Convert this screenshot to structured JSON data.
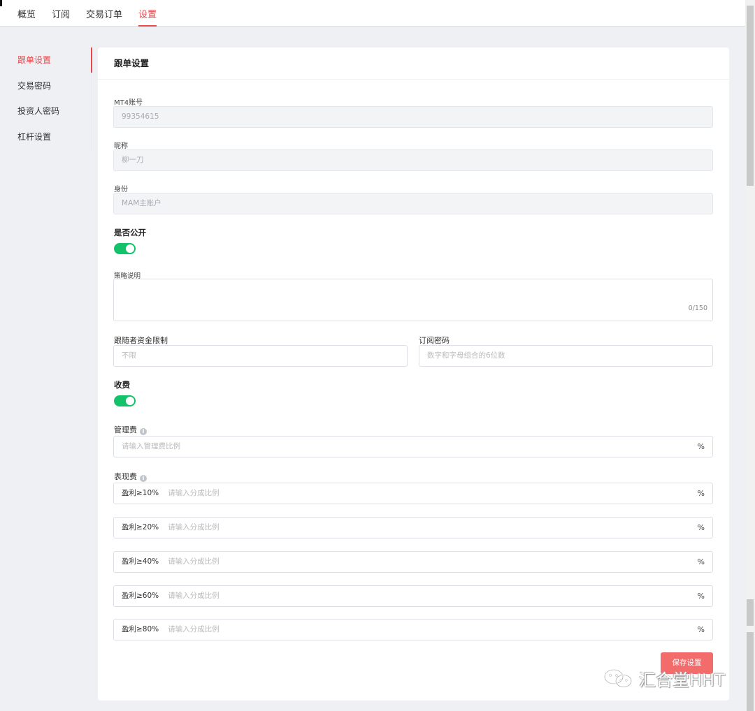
{
  "nav": {
    "tabs": [
      {
        "label": "概览"
      },
      {
        "label": "订阅"
      },
      {
        "label": "交易订单"
      },
      {
        "label": "设置"
      }
    ]
  },
  "sidebar": {
    "items": [
      {
        "label": "跟单设置"
      },
      {
        "label": "交易密码"
      },
      {
        "label": "投资人密码"
      },
      {
        "label": "杠杆设置"
      }
    ]
  },
  "card": {
    "title": "跟单设置"
  },
  "form": {
    "mt4_label": "MT4账号",
    "mt4_value": "99354615",
    "nickname_label": "昵称",
    "nickname_value": "柳一刀",
    "identity_label": "身份",
    "identity_value": "MAM主账户",
    "public_label": "是否公开",
    "public_on": true,
    "strategy_label": "策略说明",
    "strategy_count": "0/150",
    "follower_limit_label": "跟随者资金限制",
    "follower_limit_placeholder": "不限",
    "subscribe_pw_label": "订阅密码",
    "subscribe_pw_placeholder": "数字和字母组合的6位数",
    "fee_label": "收费",
    "fee_on": true,
    "mgmt_fee_label": "管理费",
    "mgmt_fee_placeholder": "请输入管理费比例",
    "percent": "%",
    "perf_fee_label": "表现费",
    "perf_tiers": [
      {
        "prefix": "盈利≥10%",
        "placeholder": "请输入分成比例"
      },
      {
        "prefix": "盈利≥20%",
        "placeholder": "请输入分成比例"
      },
      {
        "prefix": "盈利≥40%",
        "placeholder": "请输入分成比例"
      },
      {
        "prefix": "盈利≥60%",
        "placeholder": "请输入分成比例"
      },
      {
        "prefix": "盈利≥80%",
        "placeholder": "请输入分成比例"
      }
    ],
    "save_label": "保存设置"
  },
  "watermark": {
    "text": "汇合堂HHT"
  },
  "colors": {
    "accent": "#e5484d",
    "toggle_on": "#13c26a",
    "save_button": "#f36c6c"
  }
}
